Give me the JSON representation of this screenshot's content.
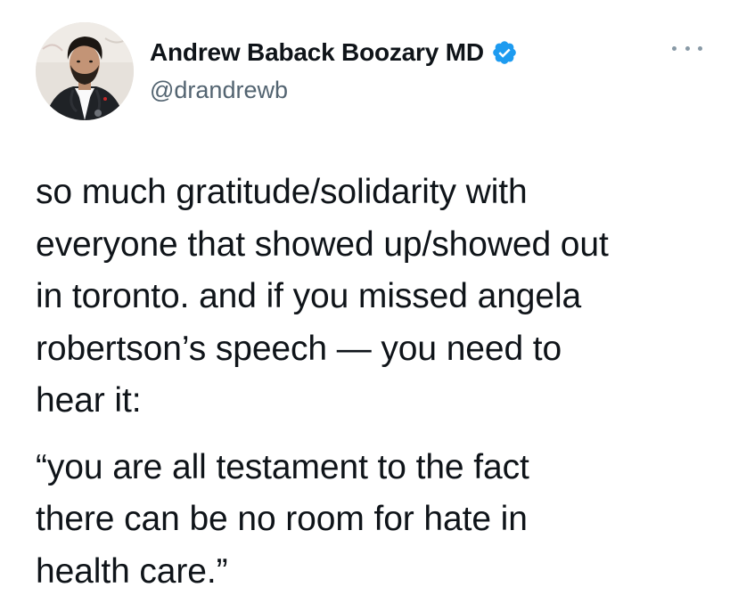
{
  "author": {
    "display_name": "Andrew Baback Boozary MD",
    "handle": "@drandrewb",
    "verified": true,
    "verified_color": "#1d9bf0"
  },
  "icons": {
    "verified": "verified-badge-icon",
    "more": "more-options-icon"
  },
  "tweet": {
    "paragraph1_lines": [
      "so much gratitude/solidarity with",
      "everyone that showed up/showed out",
      "in toronto. and if you missed angela",
      "robertson’s speech — you need to",
      "hear it:"
    ],
    "paragraph2_lines": [
      "“you are all testament to the fact",
      "there can be no room for hate in",
      "health care.”"
    ]
  }
}
